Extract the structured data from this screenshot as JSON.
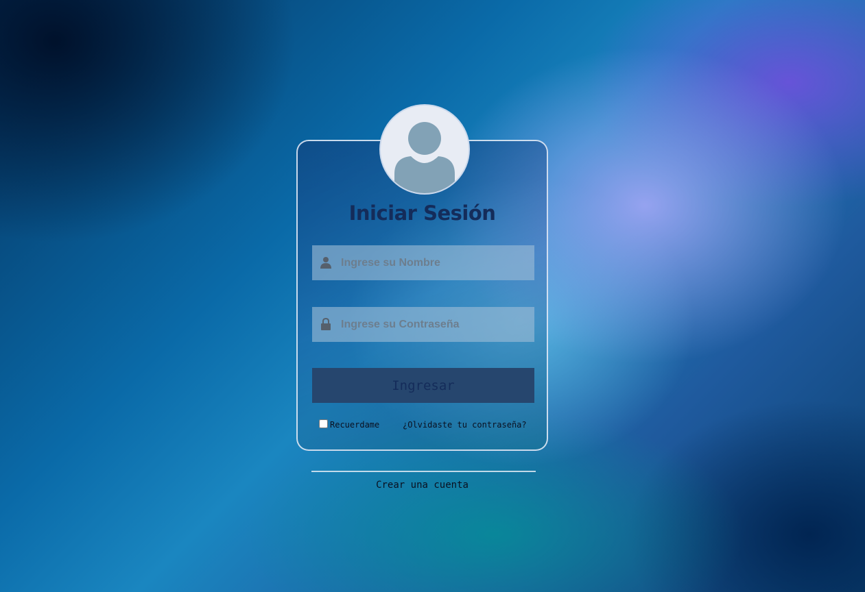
{
  "login": {
    "title": "Iniciar Sesión",
    "username": {
      "placeholder": "Ingrese su Nombre",
      "value": "",
      "icon": "user-icon"
    },
    "password": {
      "placeholder": "Ingrese su Contraseña",
      "value": "",
      "icon": "lock-icon"
    },
    "submit_label": "Ingresar",
    "remember_label": "Recuerdame",
    "remember_checked": false,
    "forgot_label": "¿Olvidaste tu contraseña?"
  },
  "footer": {
    "create_account_label": "Crear una cuenta"
  },
  "colors": {
    "title": "#142c5a",
    "button_bg": "#26466e",
    "avatar_silhouette": "#82a2b6"
  }
}
